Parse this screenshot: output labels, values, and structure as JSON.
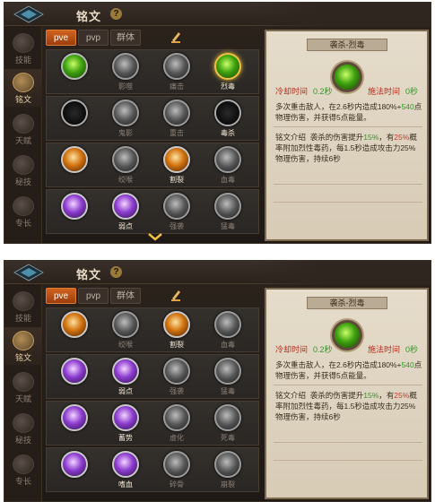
{
  "header": {
    "title": "铭文",
    "help": "?"
  },
  "nav": [
    "技能",
    "铭文",
    "天赋",
    "秘技",
    "专长"
  ],
  "tabs": [
    "pve",
    "pvp",
    "群体"
  ],
  "panel1": {
    "rows": [
      [
        {
          "label": "",
          "style": "green"
        },
        {
          "label": "影噬",
          "style": "gray"
        },
        {
          "label": "痛击",
          "style": "gray"
        },
        {
          "label": "烈毒",
          "style": "green",
          "selected": true
        }
      ],
      [
        {
          "label": "",
          "style": "eyes"
        },
        {
          "label": "鬼影",
          "style": "gray"
        },
        {
          "label": "重击",
          "style": "gray"
        },
        {
          "label": "毒杀",
          "style": "eyes"
        }
      ],
      [
        {
          "label": "",
          "style": "orange"
        },
        {
          "label": "绞喉",
          "style": "gray"
        },
        {
          "label": "割裂",
          "style": "orange"
        },
        {
          "label": "血毒",
          "style": "gray"
        }
      ],
      [
        {
          "label": "",
          "style": "purple"
        },
        {
          "label": "弱点",
          "style": "purple"
        },
        {
          "label": "强袭",
          "style": "gray"
        },
        {
          "label": "猛毒",
          "style": "gray"
        }
      ]
    ]
  },
  "panel2": {
    "rows": [
      [
        {
          "label": "",
          "style": "orange"
        },
        {
          "label": "绞喉",
          "style": "gray"
        },
        {
          "label": "割裂",
          "style": "orange"
        },
        {
          "label": "血毒",
          "style": "gray"
        }
      ],
      [
        {
          "label": "",
          "style": "purple"
        },
        {
          "label": "弱点",
          "style": "purple"
        },
        {
          "label": "强袭",
          "style": "gray"
        },
        {
          "label": "猛毒",
          "style": "gray"
        }
      ],
      [
        {
          "label": "",
          "style": "purple"
        },
        {
          "label": "蓄势",
          "style": "purple"
        },
        {
          "label": "虚化",
          "style": "gray"
        },
        {
          "label": "死毒",
          "style": "gray"
        }
      ],
      [
        {
          "label": "",
          "style": "purple"
        },
        {
          "label": "嗜血",
          "style": "purple"
        },
        {
          "label": "碎骨",
          "style": "gray"
        },
        {
          "label": "崩裂",
          "style": "gray"
        }
      ]
    ]
  },
  "detail": {
    "title": "袭杀-烈毒",
    "cooldown_label": "冷却时间",
    "cooldown_value": "0.2秒",
    "cast_label": "施法时间",
    "cast_value": "0秒",
    "desc_pre": "多次重击敌人，在2.6秒内造成180%+",
    "desc_hl": "540",
    "desc_post": "点物理伤害，并获得5点能量。",
    "ins_label": "铭文介绍",
    "ins_pre": "袭杀的伤害提升",
    "ins_v1": "15%",
    "ins_mid": "，有",
    "ins_v2": "25%",
    "ins_post": "概率附加烈性毒药，每1.5秒造成攻击力25%物理伤害，持续6秒"
  }
}
